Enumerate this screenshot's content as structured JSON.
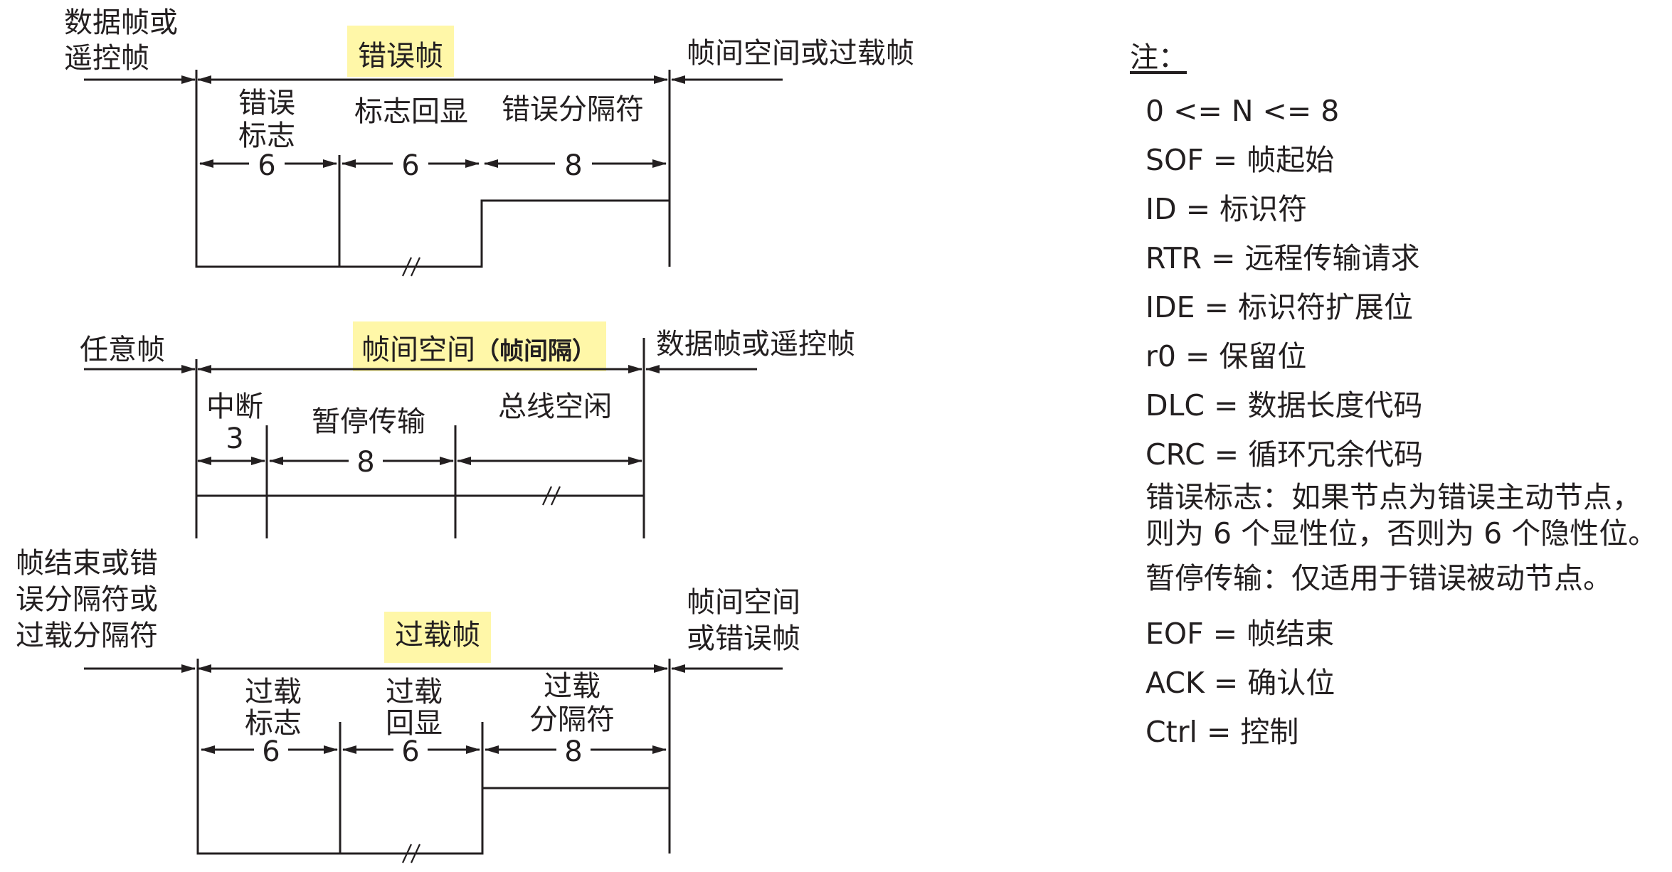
{
  "error_frame": {
    "title": "错误帧",
    "left_label": [
      "数据帧或",
      "遥控帧"
    ],
    "right_label": "帧间空间或过载帧",
    "fields": [
      {
        "label": [
          "错误",
          "标志"
        ],
        "bits": "6"
      },
      {
        "label": [
          "标志回显"
        ],
        "bits": "6"
      },
      {
        "label": [
          "错误分隔符"
        ],
        "bits": "8"
      }
    ]
  },
  "interframe": {
    "title": "帧间空间",
    "title_suffix": "（帧间隔）",
    "left_label": "任意帧",
    "right_label": "数据帧或遥控帧",
    "fields": [
      {
        "label": [
          "中断"
        ],
        "bits": "3"
      },
      {
        "label": [
          "暂停传输"
        ],
        "bits": "8"
      },
      {
        "label": [
          "总线空闲"
        ],
        "bits": ""
      }
    ]
  },
  "overload_frame": {
    "title": "过载帧",
    "left_label": [
      "帧结束或错",
      "误分隔符或",
      "过载分隔符"
    ],
    "right_label": [
      "帧间空间",
      "或错误帧"
    ],
    "fields": [
      {
        "label": [
          "过载",
          "标志"
        ],
        "bits": "6"
      },
      {
        "label": [
          "过载",
          "回显"
        ],
        "bits": "6"
      },
      {
        "label": [
          "过载",
          "分隔符"
        ],
        "bits": "8"
      }
    ]
  },
  "legend": {
    "title": "注：",
    "items": [
      "0 <= N <= 8",
      "SOF = 帧起始",
      "ID = 标识符",
      "RTR = 远程传输请求",
      "IDE = 标识符扩展位",
      "r0 = 保留位",
      "DLC = 数据长度代码",
      "CRC = 循环冗余代码"
    ],
    "notes": [
      "错误标志：如果节点为错误主动节点，",
      "则为 6 个显性位，否则为 6 个隐性位。",
      "暂停传输：仅适用于错误被动节点。"
    ],
    "items2": [
      "EOF = 帧结束",
      "ACK = 确认位",
      "Ctrl = 控制"
    ]
  },
  "colors": {
    "highlight": "#fff7a8",
    "ink": "#231f20"
  }
}
